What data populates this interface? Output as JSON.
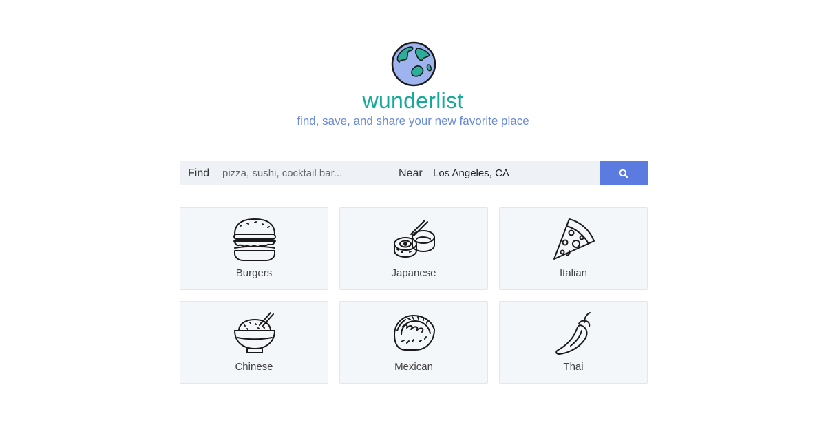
{
  "header": {
    "brand": "wunderlist",
    "tagline": "find, save, and share your new favorite place",
    "logo_icon": "globe-icon"
  },
  "search": {
    "find_label": "Find",
    "find_placeholder": "pizza, sushi, cocktail bar...",
    "near_label": "Near",
    "near_value": "Los Angeles, CA",
    "button_icon": "search-icon"
  },
  "categories": [
    {
      "label": "Burgers",
      "icon": "burger-icon"
    },
    {
      "label": "Japanese",
      "icon": "sushi-icon"
    },
    {
      "label": "Italian",
      "icon": "pizza-slice-icon"
    },
    {
      "label": "Chinese",
      "icon": "rice-bowl-icon"
    },
    {
      "label": "Mexican",
      "icon": "taco-icon"
    },
    {
      "label": "Thai",
      "icon": "chili-pepper-icon"
    }
  ],
  "colors": {
    "brand": "#16a89a",
    "tagline": "#6a8ad8",
    "button": "#5b7be0",
    "field_bg": "#eef1f5",
    "card_bg": "#f4f7fa"
  }
}
